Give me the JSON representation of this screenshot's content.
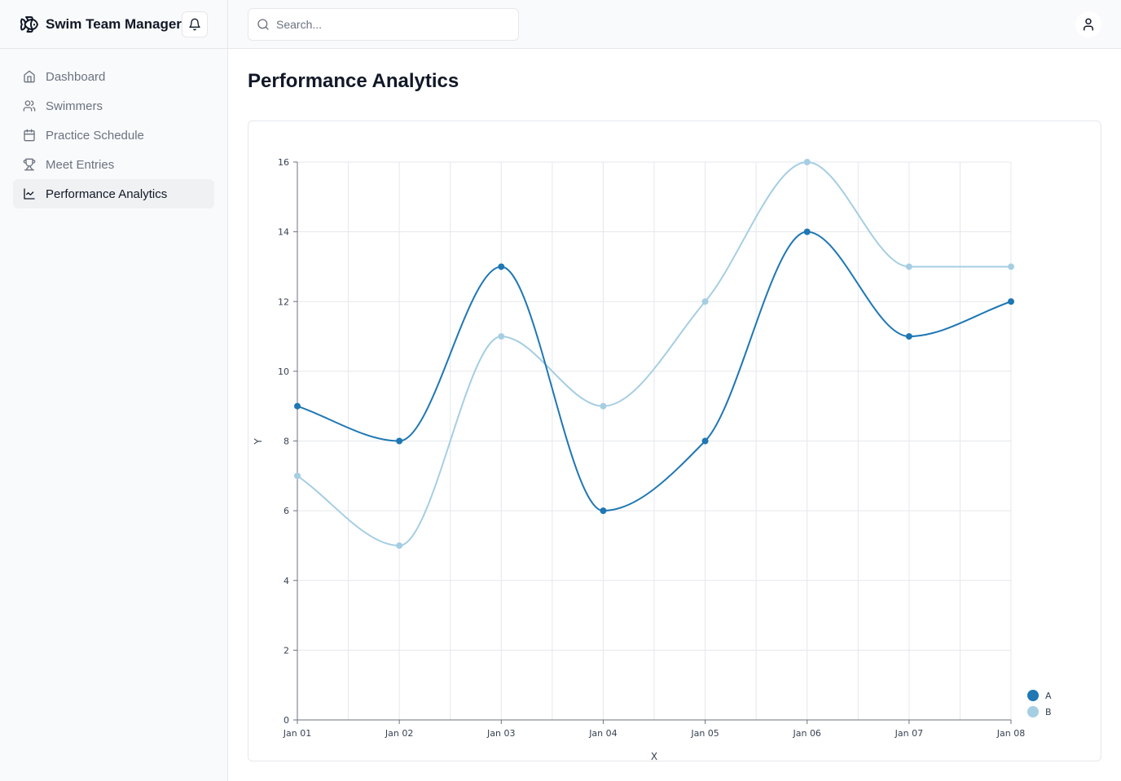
{
  "app": {
    "title": "Swim Team Manager"
  },
  "icons": {
    "logo": "fish-icon",
    "notifications": "bell-icon",
    "search": "search-icon",
    "user": "user-icon"
  },
  "sidebar": {
    "items": [
      {
        "label": "Dashboard",
        "icon": "home-icon",
        "active": false
      },
      {
        "label": "Swimmers",
        "icon": "users-icon",
        "active": false
      },
      {
        "label": "Practice Schedule",
        "icon": "calendar-icon",
        "active": false
      },
      {
        "label": "Meet Entries",
        "icon": "trophy-icon",
        "active": false
      },
      {
        "label": "Performance Analytics",
        "icon": "line-chart-icon",
        "active": true
      }
    ]
  },
  "search": {
    "placeholder": "Search..."
  },
  "main": {
    "title": "Performance Analytics"
  },
  "colors": {
    "series_a": "#1f77b4",
    "series_b": "#a6cee3",
    "grid": "#e5e7eb",
    "active_nav_bg": "#f0f1f3"
  },
  "chart_data": {
    "type": "line",
    "curve": "smooth",
    "categories": [
      "Jan 01",
      "Jan 02",
      "Jan 03",
      "Jan 04",
      "Jan 05",
      "Jan 06",
      "Jan 07",
      "Jan 08"
    ],
    "series": [
      {
        "name": "A",
        "color": "#1f77b4",
        "values": [
          9,
          8,
          13,
          6,
          8,
          14,
          11,
          12
        ]
      },
      {
        "name": "B",
        "color": "#a6cee3",
        "values": [
          7,
          5,
          11,
          9,
          12,
          16,
          13,
          13
        ]
      }
    ],
    "xlabel": "X",
    "ylabel": "Y",
    "ylim": [
      0,
      16
    ],
    "yticks": [
      0,
      2,
      4,
      6,
      8,
      10,
      12,
      14,
      16
    ],
    "grid": true,
    "legend_position": "bottom-right"
  }
}
